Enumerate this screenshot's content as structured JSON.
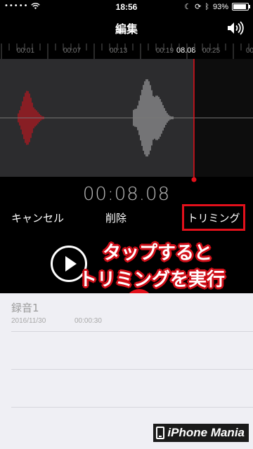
{
  "status_bar": {
    "signal": "•••••",
    "time": "18:56",
    "battery_pct": "93%",
    "battery_level": 0.93
  },
  "header": {
    "title": "編集"
  },
  "timeline": {
    "ticks": [
      "00:01",
      "00:07",
      "00:13",
      "00:19",
      "00:25",
      "00"
    ],
    "playhead": "08.08"
  },
  "editor": {
    "elapsed": "00:08.08",
    "cancel_label": "キャンセル",
    "delete_label": "削除",
    "trim_label": "トリミング",
    "accent_color": "#e3101b"
  },
  "annotation": {
    "line1": "タップすると",
    "line2": "トリミングを実行"
  },
  "recordings": [
    {
      "name": "録音1",
      "date": "2016/11/30",
      "duration": "00:00:30"
    }
  ],
  "watermark": {
    "text": "iPhone Mania"
  }
}
